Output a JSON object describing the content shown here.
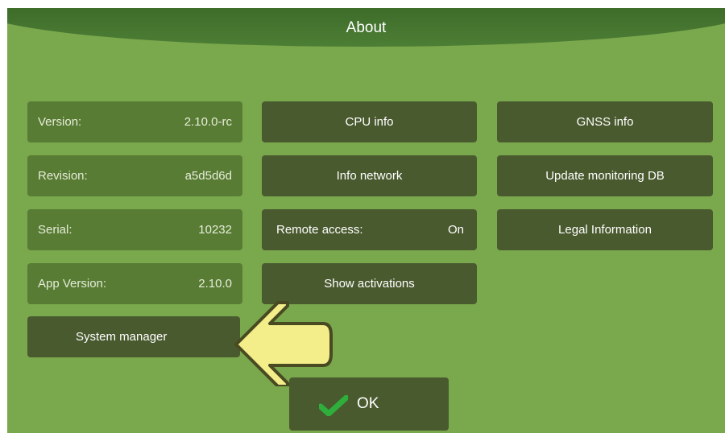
{
  "header": {
    "title": "About"
  },
  "info": {
    "version": {
      "label": "Version:",
      "value": "2.10.0-rc"
    },
    "revision": {
      "label": "Revision:",
      "value": "a5d5d6d"
    },
    "serial": {
      "label": "Serial:",
      "value": "10232"
    },
    "app_version": {
      "label": "App Version:",
      "value": "2.10.0"
    }
  },
  "buttons": {
    "system_manager": "System manager",
    "cpu_info": "CPU info",
    "info_network": "Info network",
    "remote_access": {
      "label": "Remote access:",
      "value": "On"
    },
    "show_activations": "Show activations",
    "gnss_info": "GNSS info",
    "update_monitoring_db": "Update monitoring DB",
    "legal_information": "Legal Information",
    "ok": "OK"
  },
  "icons": {
    "ok": "checkmark-icon",
    "annotation": "arrow-left-icon"
  },
  "colors": {
    "background": "#7aa84d",
    "header": "#3f6e2b",
    "info_tile": "#587c34",
    "button": "#4a5a2f",
    "checkmark": "#2eae3b",
    "arrow_fill": "#f3ee8a",
    "arrow_stroke": "#494a22"
  }
}
